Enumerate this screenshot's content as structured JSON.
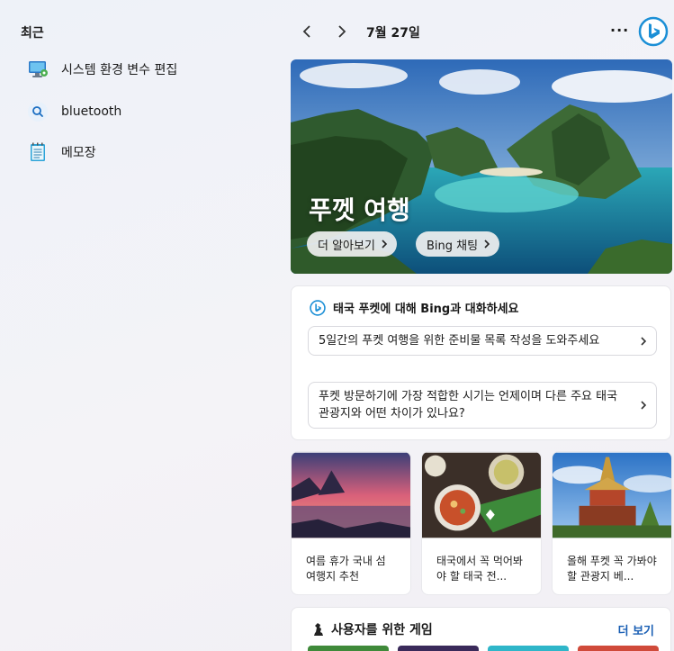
{
  "recent": {
    "title": "최근",
    "items": [
      {
        "label": "시스템 환경 변수 편집",
        "icon": "monitor-settings-icon"
      },
      {
        "label": "bluetooth",
        "icon": "search-icon"
      },
      {
        "label": "메모장",
        "icon": "notepad-icon"
      }
    ]
  },
  "header": {
    "date": "7월 27일",
    "more": "···"
  },
  "hero": {
    "title": "푸껫 여행",
    "learn_more": "더 알아보기",
    "bing_chat": "Bing 채팅"
  },
  "chat": {
    "title": "태국 푸켓에 대해 Bing과 대화하세요",
    "questions": [
      "5일간의 푸켓 여행을 위한 준비물 목록 작성을 도와주세요",
      "푸켓 방문하기에 가장 적합한 시기는 언제이며 다른 주요 태국 관광지와 어떤 차이가 있나요?"
    ]
  },
  "news": [
    {
      "caption": "여름 휴가 국내 섬 여행지 추천"
    },
    {
      "caption": "태국에서 꼭 먹어봐야 할 태국 전..."
    },
    {
      "caption": "올해 푸켓 꼭 가봐야 할 관광지 베..."
    }
  ],
  "games": {
    "title": "사용자를 위한 게임",
    "more": "더 보기"
  },
  "colors": {
    "accent": "#1a5fb4",
    "bing_blue": "#1b8fd6"
  }
}
